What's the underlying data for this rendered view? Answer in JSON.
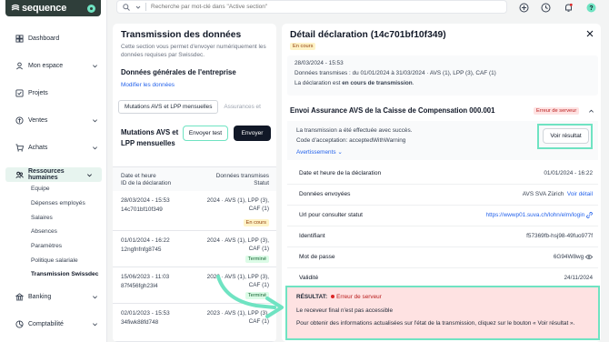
{
  "app": {
    "name": "sequence"
  },
  "search": {
    "placeholder": "Recherche par mot-clé dans \"Active section\""
  },
  "topbar": {
    "icons": [
      "plus-circle-icon",
      "clock-icon",
      "bell-icon",
      "help-icon"
    ]
  },
  "sidebar": {
    "items": [
      {
        "label": "Dashboard",
        "icon": "dashboard-icon"
      },
      {
        "label": "Mon espace",
        "icon": "user-icon"
      },
      {
        "label": "Projets",
        "icon": "checkbox-icon"
      },
      {
        "label": "Ventes",
        "icon": "sales-icon"
      },
      {
        "label": "Achats",
        "icon": "cart-icon"
      },
      {
        "label": "Ressources humaines",
        "icon": "people-icon",
        "active": true
      },
      {
        "label": "Banking",
        "icon": "bank-icon"
      },
      {
        "label": "Comptabilité",
        "icon": "accounting-icon"
      }
    ],
    "sub_items": [
      "Equipe",
      "Dépenses employés",
      "Salaires",
      "Absences",
      "Paramètres",
      "Politique salariale",
      "Transmission Swissdec"
    ]
  },
  "left_panel": {
    "title": "Transmission des données",
    "description": "Cette section vous permet d'envoyer numériquement les données requises par Swissdec.",
    "company_heading": "Données générales de l'entreprise",
    "modify_link": "Modifier les données",
    "tabs": [
      "Mutations AVS et LPP mensuelles",
      "Assurances et"
    ],
    "mutations_title": "Mutations AVS et LPP mensuelles",
    "btn_test": "Envoyer test",
    "btn_send": "Envoyer",
    "table": {
      "col1_line1": "Date et heure",
      "col1_line2": "ID de la déclaration",
      "col2_line1": "Données transmises",
      "col2_line2": "Statut",
      "rows": [
        {
          "date": "28/03/2024 - 15:53",
          "id": "14c701bf10f349",
          "data": "2024 · AVS (1), LPP (3), CAF (1)",
          "status": "En cours",
          "status_type": "pending"
        },
        {
          "date": "01/01/2024 - 16:22",
          "id": "12ngfnfnfg8745",
          "data": "2024 · AVS (1), LPP (3), CAF (1)",
          "status": "Terminé",
          "status_type": "done"
        },
        {
          "date": "15/06/2023 - 11:03",
          "id": "87f456fgh23l4",
          "data": "2023 · AVS (1), LPP (3), CAF (1)",
          "status": "Terminé",
          "status_type": "done"
        },
        {
          "date": "02/01/2023 - 15:53",
          "id": "34fiwk88fd748",
          "data": "2023 · AVS (1), LPP (3), CAF (1)",
          "status": "",
          "status_type": ""
        }
      ]
    }
  },
  "right_panel": {
    "title": "Détail déclaration (14c701bf10f349)",
    "status": "En cours",
    "info": {
      "date": "28/03/2024 - 15:53",
      "transmitted": "Données transmises : du 01/01/2024 à 31/03/2024 · AVS (1), LPP (3), CAF (1)",
      "state_prefix": "La déclaration est ",
      "state_bold": "en cours de transmission",
      "state_suffix": "."
    },
    "envoi": {
      "title": "Envoi Assurance AVS de la Caisse de Compensation 000.001",
      "badge": "Erreur de serveur",
      "line1": "La transmission a été effectuée avec succès.",
      "line2": "Code d'acceptation: acceptedWithWarning",
      "warnings_link": "Avertissements",
      "voir_button": "Voir résultat"
    },
    "details": [
      {
        "label": "Date et heure de la déclaration",
        "value": "01/01/2024 - 16:22",
        "link": ""
      },
      {
        "label": "Données envoyées",
        "value": "AVS SVA Zürich",
        "link": "Voir détail"
      },
      {
        "label": "Url pour consulter statut",
        "value": "",
        "link": "https://wwwp01.suva.ch/lohn/elm/login"
      },
      {
        "label": "Identifiant",
        "value": "f57369fb-hsj98-49fuo977f",
        "link": ""
      },
      {
        "label": "Mot de passe",
        "value": "6G94W8wg",
        "link": ""
      },
      {
        "label": "Validité",
        "value": "24/11/2024",
        "link": ""
      }
    ],
    "result": {
      "label": "RÉSULTAT:",
      "error": "Erreur de serveur",
      "line1": "Le receveur final n'est pas accessible",
      "line2": "Pour obtenir des informations actualisées sur l'état de la transmission, cliquez sur le bouton « Voir résultat »."
    }
  },
  "colors": {
    "accent": "#6fe3c2",
    "dark": "#2f3e3a",
    "link": "#2563eb",
    "error_bg": "#fee2e2",
    "error": "#b91c1c"
  }
}
